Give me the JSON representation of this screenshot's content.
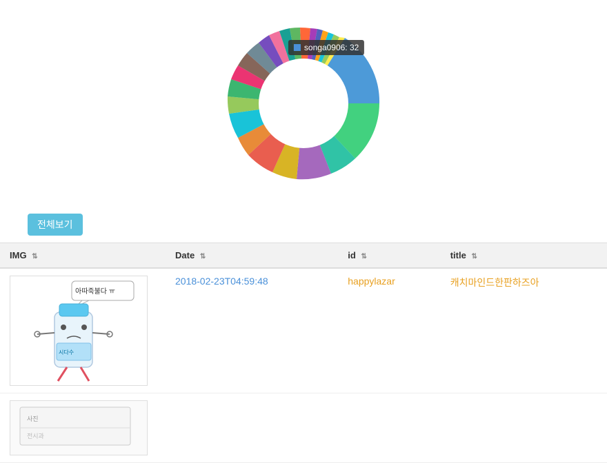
{
  "chart": {
    "tooltip": {
      "label": "songa0906: 32",
      "color": "#4a90d9"
    }
  },
  "buttons": {
    "view_all": "전체보기"
  },
  "table": {
    "columns": [
      {
        "key": "img",
        "label": "IMG"
      },
      {
        "key": "date",
        "label": "Date"
      },
      {
        "key": "id",
        "label": "id"
      },
      {
        "key": "title",
        "label": "title"
      }
    ],
    "rows": [
      {
        "date": "2018-02-23T04:59:48",
        "id": "happylazar",
        "title": "캐치마인드한판하즈아"
      },
      {
        "date": "",
        "id": "",
        "title": ""
      }
    ]
  }
}
